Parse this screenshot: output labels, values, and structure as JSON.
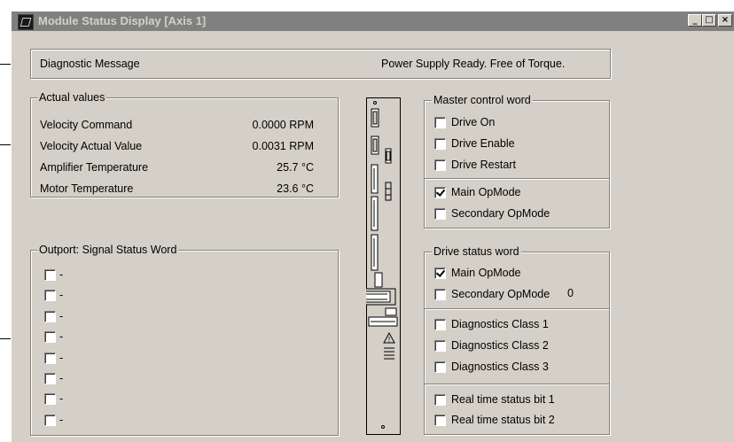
{
  "window": {
    "title": "Module Status Display [Axis 1]",
    "controls": [
      "_",
      "□",
      "×"
    ]
  },
  "diagnostic": {
    "label": "Diagnostic Message",
    "message": "Power Supply Ready. Free of Torque."
  },
  "actual_values": {
    "title": "Actual values",
    "rows": [
      {
        "label": "Velocity Command",
        "value": "0.0000 RPM"
      },
      {
        "label": "Velocity Actual Value",
        "value": "0.0031 RPM"
      },
      {
        "label": "Amplifier Temperature",
        "value": "25.7 °C"
      },
      {
        "label": "Motor Temperature",
        "value": "23.6 °C"
      }
    ]
  },
  "outport": {
    "title": "Outport: Signal Status Word",
    "items": [
      {
        "label": "-",
        "checked": false
      },
      {
        "label": "-",
        "checked": false
      },
      {
        "label": "-",
        "checked": false
      },
      {
        "label": "-",
        "checked": false
      },
      {
        "label": "-",
        "checked": false
      },
      {
        "label": "-",
        "checked": false
      },
      {
        "label": "-",
        "checked": false
      },
      {
        "label": "-",
        "checked": false
      }
    ]
  },
  "master_control": {
    "title": "Master control word",
    "items": [
      {
        "label": "Drive On",
        "checked": false
      },
      {
        "label": "Drive Enable",
        "checked": false
      },
      {
        "label": "Drive Restart",
        "checked": false
      },
      {
        "label": "Main OpMode",
        "checked": true
      },
      {
        "label": "Secondary OpMode",
        "checked": false
      }
    ]
  },
  "drive_status": {
    "title": "Drive status word",
    "items": [
      {
        "label": "Main OpMode",
        "checked": true
      },
      {
        "label": "Secondary OpMode",
        "checked": false,
        "suffix": "0"
      },
      {
        "label": "Diagnostics Class 1",
        "checked": false
      },
      {
        "label": "Diagnostics Class 2",
        "checked": false
      },
      {
        "label": "Diagnostics Class 3",
        "checked": false
      },
      {
        "label": "Real time status bit 1",
        "checked": false
      },
      {
        "label": "Real time status bit 2",
        "checked": false
      }
    ]
  }
}
